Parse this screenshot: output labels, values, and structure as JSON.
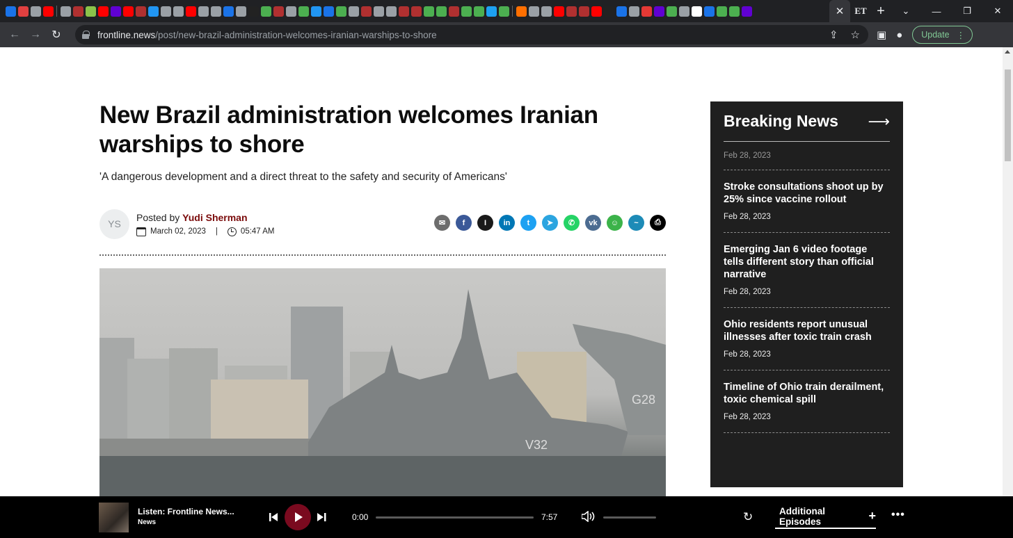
{
  "browser": {
    "tab_icons": [
      "#1a73e8",
      "#e04040",
      "#9aa0a6",
      "#ff0000",
      "#9aa0a6",
      "#b03030",
      "#8bc34a",
      "#ff0000",
      "#6001d2",
      "#ff0000",
      "#b03030",
      "#2196f3",
      "#9aa0a6",
      "#9aa0a6",
      "#ff0000",
      "#9aa0a6",
      "#9aa0a6",
      "#1a73e8",
      "#9aa0a6",
      "#222222",
      "#4caf50",
      "#b03030",
      "#9aa0a6",
      "#4caf50",
      "#2196f3",
      "#1a73e8",
      "#4caf50",
      "#9aa0a6",
      "#b03030",
      "#9aa0a6",
      "#9aa0a6",
      "#b03030",
      "#b03030",
      "#4caf50",
      "#4caf50",
      "#b03030",
      "#4caf50",
      "#4caf50",
      "#1da1f2",
      "#4caf50",
      "#ff6f00",
      "#9aa0a6",
      "#9aa0a6",
      "#ff0000",
      "#b03030",
      "#b03030",
      "#ff0000",
      "#222222",
      "#1a73e8",
      "#9aa0a6",
      "#e53935",
      "#6001d2",
      "#4caf50",
      "#9aa0a6",
      "#ffffff",
      "#1a73e8",
      "#4caf50",
      "#4caf50",
      "#6001d2"
    ],
    "active_tab_icon": "ET",
    "url_host": "frontline.news",
    "url_path": "/post/new-brazil-administration-welcomes-iranian-warships-to-shore",
    "update_label": "Update"
  },
  "article": {
    "headline": "New Brazil administration welcomes Iranian warships to shore",
    "subhead": "'A dangerous development and a direct threat to the safety and security of Americans'",
    "avatar_initials": "YS",
    "posted_by": "Posted by",
    "author": "Yudi Sherman",
    "date": "March 02, 2023",
    "time": "05:47 AM",
    "share_icons": [
      {
        "name": "email-share-icon",
        "color": "#6d6d6d",
        "glyph": "✉"
      },
      {
        "name": "facebook-share-icon",
        "color": "#3b5998",
        "glyph": "f"
      },
      {
        "name": "instapaper-share-icon",
        "color": "#1a1a1a",
        "glyph": "I"
      },
      {
        "name": "linkedin-share-icon",
        "color": "#0077b5",
        "glyph": "in"
      },
      {
        "name": "twitter-share-icon",
        "color": "#1da1f2",
        "glyph": "t"
      },
      {
        "name": "telegram-share-icon",
        "color": "#2ca5e0",
        "glyph": "➤"
      },
      {
        "name": "whatsapp-share-icon",
        "color": "#25d366",
        "glyph": "✆"
      },
      {
        "name": "vk-share-icon",
        "color": "#4c6c91",
        "glyph": "vk"
      },
      {
        "name": "ok-share-icon",
        "color": "#3cb34a",
        "glyph": "☺"
      },
      {
        "name": "livejournal-share-icon",
        "color": "#1d8bb7",
        "glyph": "~"
      },
      {
        "name": "print-share-icon",
        "color": "#000000",
        "glyph": "⎙"
      }
    ],
    "hero_alt": "V32 G28"
  },
  "sidebar": {
    "title": "Breaking News",
    "first_date": "Feb 28, 2023",
    "items": [
      {
        "title": "Stroke consultations shoot up by 25% since vaccine rollout",
        "date": "Feb 28, 2023"
      },
      {
        "title": "Emerging Jan 6 video footage tells different story than official narrative",
        "date": "Feb 28, 2023"
      },
      {
        "title": "Ohio residents report unusual illnesses after toxic train crash",
        "date": "Feb 28, 2023"
      },
      {
        "title": "Timeline of Ohio train derailment, toxic chemical spill",
        "date": "Feb 28, 2023"
      }
    ]
  },
  "player": {
    "title": "Listen: Frontline News...",
    "subtitle": "News",
    "current_time": "0:00",
    "total_time": "7:57",
    "additional_label": "Additional Episodes"
  }
}
